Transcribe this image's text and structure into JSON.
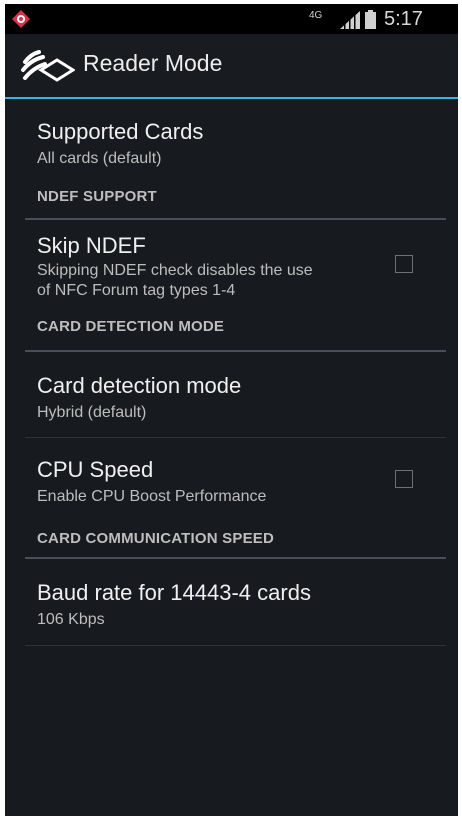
{
  "status_bar": {
    "network_type": "4G",
    "time": "5:17 PM",
    "icons": [
      "notification-app-icon",
      "signal-icon",
      "battery-icon"
    ]
  },
  "action_bar": {
    "title": "Reader Mode",
    "icon": "reader-mode-app-icon",
    "accent_color": "#33b5e5"
  },
  "settings": {
    "supported_cards": {
      "title": "Supported Cards",
      "summary": "All cards (default)"
    },
    "ndef_header": "NDEF SUPPORT",
    "skip_ndef": {
      "title": "Skip NDEF",
      "summary_line1": "Skipping NDEF check disables the use",
      "summary_line2": "of NFC Forum tag types 1-4",
      "checked": false
    },
    "card_detection_header": "CARD DETECTION MODE",
    "card_detection_mode": {
      "title": "Card detection mode",
      "summary": "Hybrid (default)"
    },
    "cpu_speed": {
      "title": "CPU Speed",
      "summary": "Enable CPU Boost Performance",
      "checked": false
    },
    "comm_speed_header": "CARD COMMUNICATION SPEED",
    "baud_rate": {
      "title": "Baud rate for 14443-4 cards",
      "summary": "106 Kbps"
    }
  }
}
